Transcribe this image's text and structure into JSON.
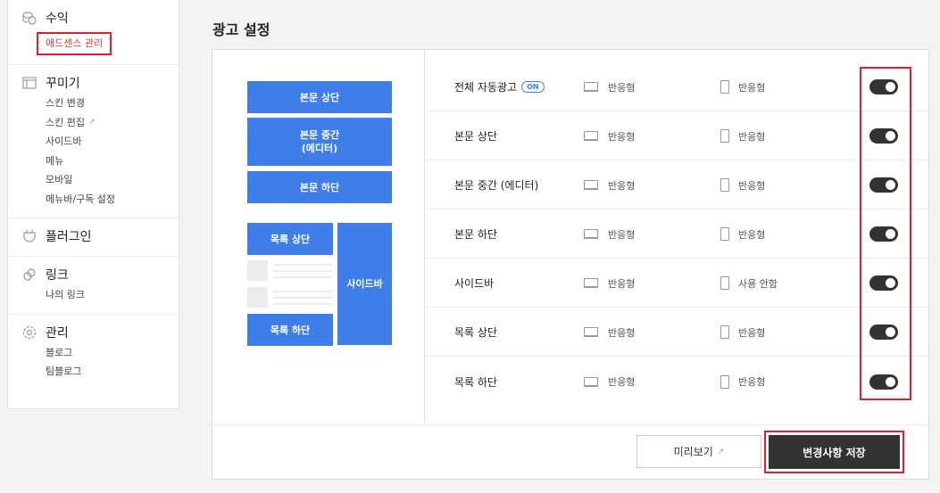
{
  "sidebar": {
    "groups": [
      {
        "title": "수익",
        "icon": "coins-icon",
        "items": [],
        "active_item": "애드센스 관리"
      },
      {
        "title": "꾸미기",
        "icon": "layout-icon",
        "items": [
          "스킨 변경",
          "스킨 편집",
          "사이드바",
          "메뉴",
          "모바일",
          "메뉴바/구독 설정"
        ]
      },
      {
        "title": "플러그인",
        "icon": "plug-icon",
        "items": []
      },
      {
        "title": "링크",
        "icon": "link-icon",
        "items": [
          "나의 링크"
        ]
      },
      {
        "title": "관리",
        "icon": "gear-icon",
        "items": [
          "블로그",
          "팀블로그"
        ]
      }
    ],
    "external_link_icon": "↗"
  },
  "page_title": "광고 설정",
  "preview": {
    "top": "본문 상단",
    "middle_line1": "본문 중간",
    "middle_line2": "(에디터)",
    "bottom": "본문 하단",
    "list_top": "목록 상단",
    "list_bottom": "목록 하단",
    "sidebar": "사이드바"
  },
  "rows": [
    {
      "name": "전체 자동광고",
      "badge": "ON",
      "desktop": "반응형",
      "mobile": "반응형",
      "enabled": true
    },
    {
      "name": "본문 상단",
      "desktop": "반응형",
      "mobile": "반응형",
      "enabled": true
    },
    {
      "name": "본문 중간 (에디터)",
      "desktop": "반응형",
      "mobile": "반응형",
      "enabled": true
    },
    {
      "name": "본문 하단",
      "desktop": "반응형",
      "mobile": "반응형",
      "enabled": true
    },
    {
      "name": "사이드바",
      "desktop": "반응형",
      "mobile": "사용 안함",
      "enabled": true
    },
    {
      "name": "목록 상단",
      "desktop": "반응형",
      "mobile": "반응형",
      "enabled": true
    },
    {
      "name": "목록 하단",
      "desktop": "반응형",
      "mobile": "반응형",
      "enabled": true
    }
  ],
  "footer": {
    "preview_label": "미리보기",
    "save_label": "변경사항 저장"
  },
  "colors": {
    "accent_blue": "#3f7ee8",
    "toggle_on": "#333333",
    "highlight_red": "#e0202a"
  }
}
